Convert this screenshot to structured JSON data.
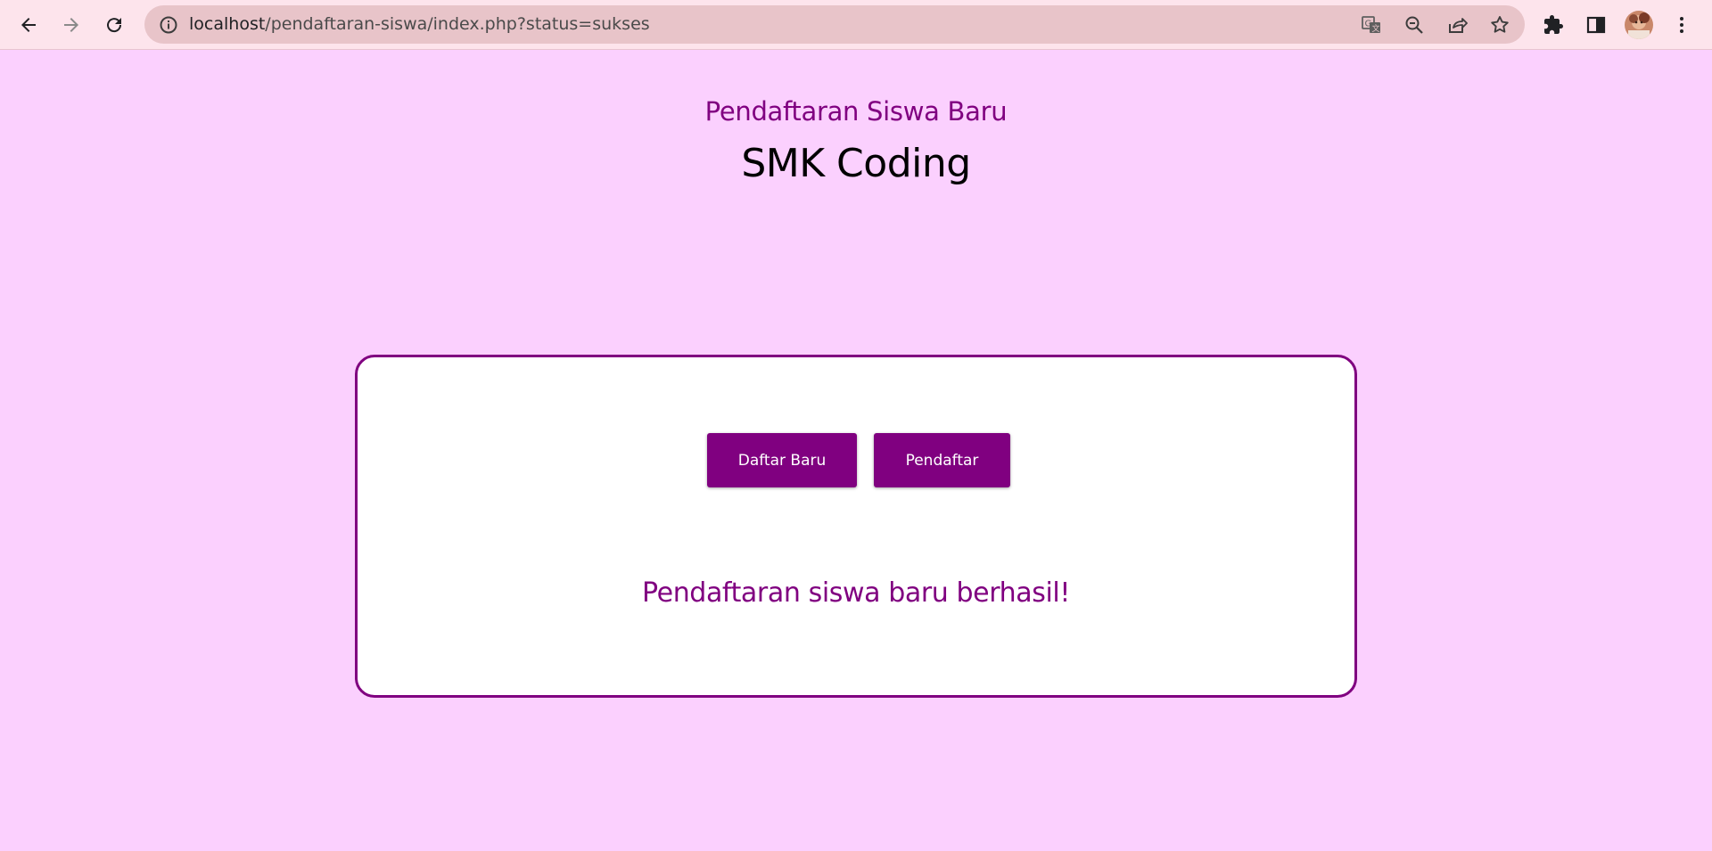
{
  "browser": {
    "url_host": "localhost",
    "url_path": "/pendaftaran-siswa/index.php?status=sukses",
    "icons": {
      "back": "back-arrow-icon",
      "forward": "forward-arrow-icon",
      "reload": "reload-icon",
      "info": "site-info-icon",
      "translate": "translate-icon",
      "zoom": "zoom-out-icon",
      "share": "share-icon",
      "bookmark": "bookmark-star-icon",
      "extensions": "extensions-puzzle-icon",
      "side_panel": "side-panel-icon",
      "profile": "profile-avatar",
      "menu": "kebab-menu-icon"
    }
  },
  "header": {
    "subtitle": "Pendaftaran Siswa Baru",
    "title": "SMK Coding"
  },
  "card": {
    "buttons": {
      "daftar_baru": "Daftar Baru",
      "pendaftar": "Pendaftar"
    },
    "message": "Pendaftaran siswa baru berhasil!"
  },
  "colors": {
    "page_background": "#fbd0fe",
    "accent": "#800080",
    "card_background": "#ffffff",
    "toolbar_background": "#fde4ec",
    "omnibox_background": "#e8c4c9"
  }
}
